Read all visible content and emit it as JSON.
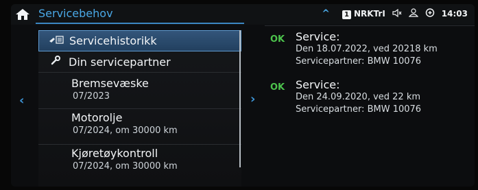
{
  "header": {
    "title": "Servicebehov",
    "radio_badge": "1",
    "radio_station": "NRKTrI",
    "time": "14:03"
  },
  "menu": {
    "items": [
      {
        "label": "Servicehistorikk",
        "icon": "service-history-icon"
      },
      {
        "label": "Din servicepartner",
        "icon": "wrench-icon"
      }
    ],
    "entries": [
      {
        "name": "Bremsevæske",
        "date": "07/2023"
      },
      {
        "name": "Motorolje",
        "date": "07/2024, om 30000 km"
      },
      {
        "name": "Kjøretøykontroll",
        "date": "07/2024, om 30000 km"
      }
    ]
  },
  "records": [
    {
      "status": "OK",
      "title": "Service:",
      "line1": "Den 18.07.2022, ved 20218 km",
      "line2": "Servicepartner: BMW 10076"
    },
    {
      "status": "OK",
      "title": "Service:",
      "line1": "Den 24.09.2020, ved 22 km",
      "line2": "Servicepartner: BMW 10076"
    }
  ],
  "colors": {
    "accent": "#4aa8e6",
    "ok": "#4cc24c",
    "background": "#0c0d0f"
  }
}
